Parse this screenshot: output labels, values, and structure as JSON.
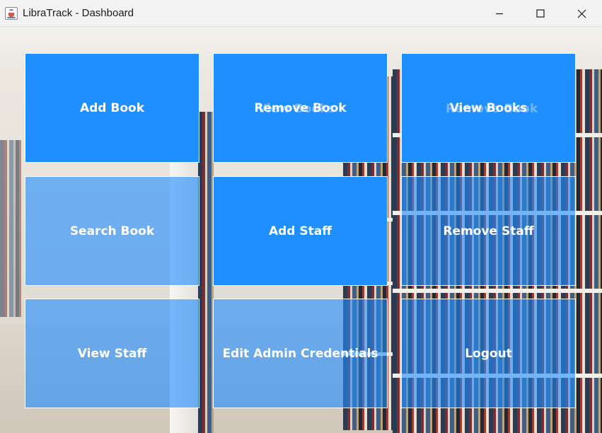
{
  "window": {
    "title": "LibraTrack - Dashboard",
    "app_icon": "java-cup-icon",
    "controls": {
      "minimize_icon": "minimize-icon",
      "maximize_icon": "maximize-icon",
      "close_icon": "close-icon"
    }
  },
  "theme": {
    "tile_color": "#1f8fff",
    "tile_text_color": "#ffffff",
    "tile_border_color": "#ffffff"
  },
  "dashboard": {
    "tiles": [
      {
        "label": "Add Book",
        "style": "solid"
      },
      {
        "label": "Remove Book",
        "style": "solid"
      },
      {
        "label": "View Books",
        "style": "solid"
      },
      {
        "label": "Search Book",
        "style": "translucent"
      },
      {
        "label": "Add Staff",
        "style": "solid"
      },
      {
        "label": "Remove Staff",
        "style": "translucent"
      },
      {
        "label": "View Staff",
        "style": "translucent"
      },
      {
        "label": "Edit Admin Credentials",
        "style": "translucent"
      },
      {
        "label": "Logout",
        "style": "translucent"
      }
    ]
  }
}
